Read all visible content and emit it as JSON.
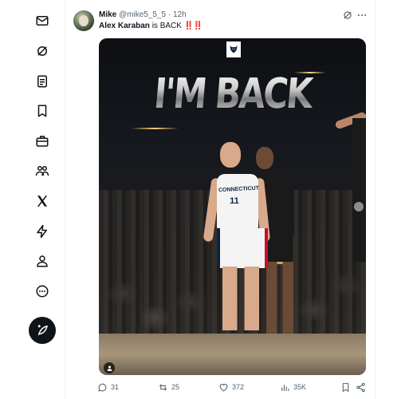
{
  "sidebar": {
    "items": [
      {
        "icon": "mail-icon",
        "label": "Messages"
      },
      {
        "icon": "grok-icon",
        "label": "Grok"
      },
      {
        "icon": "list-icon",
        "label": "Lists"
      },
      {
        "icon": "bookmark-icon",
        "label": "Bookmarks"
      },
      {
        "icon": "briefcase-icon",
        "label": "Jobs"
      },
      {
        "icon": "communities-icon",
        "label": "Communities"
      },
      {
        "icon": "x-logo-icon",
        "label": "Premium"
      },
      {
        "icon": "lightning-icon",
        "label": "Verified Orgs"
      },
      {
        "icon": "profile-icon",
        "label": "Profile"
      },
      {
        "icon": "more-circle-icon",
        "label": "More"
      }
    ],
    "compose_icon": "compose-feather-icon"
  },
  "tweet": {
    "author_name": "Mike",
    "handle": "@mike5_5_5",
    "separator": "·",
    "time": "12h",
    "text_bold": "Alex Karaban",
    "text_rest": " is BACK ",
    "text_emphasis": "‼️‼️",
    "media": {
      "headline": "I'M BACK",
      "jersey_text": "CONNECTICUT",
      "jersey_number": "11"
    },
    "actions": {
      "replies": "31",
      "retweets": "25",
      "likes": "372",
      "views": "35K"
    }
  },
  "colors": {
    "text_primary": "#0f1419",
    "text_secondary": "#536471",
    "emphasis": "#d1242f"
  }
}
